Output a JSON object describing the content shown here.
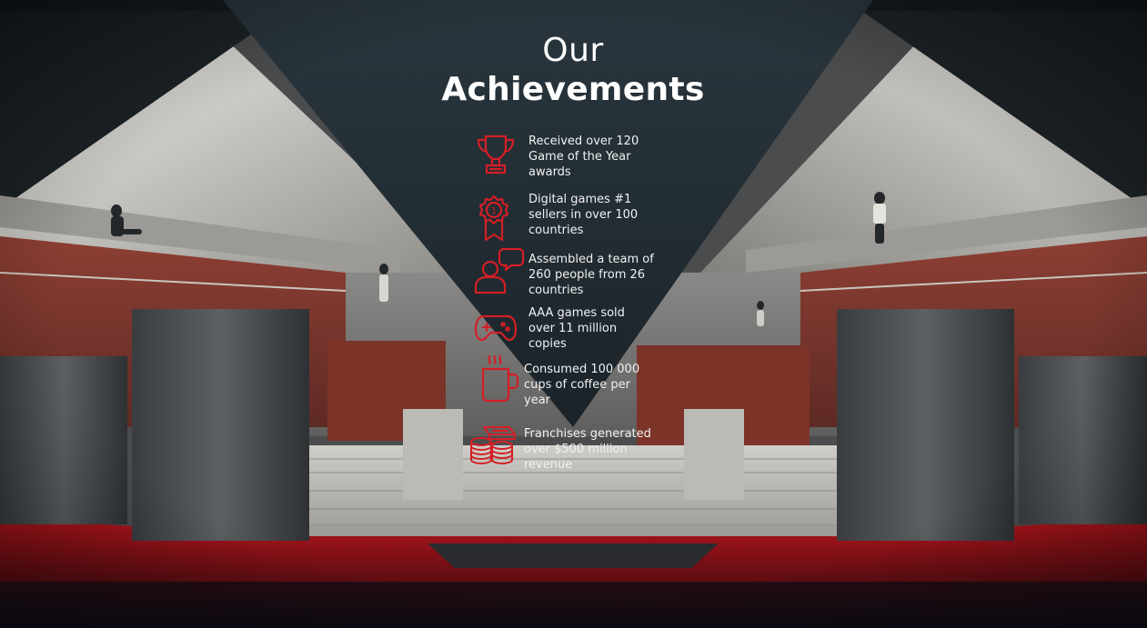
{
  "heading": {
    "line1": "Our",
    "line2": "Achievements"
  },
  "achievements": [
    {
      "icon": "trophy-icon",
      "text": "Received over 120 Game of the Year awards"
    },
    {
      "icon": "medal-icon",
      "text": "Digital games #1 sellers in over 100 countries"
    },
    {
      "icon": "team-chat-icon",
      "text": "Assembled a team of 260 people from 26 countries"
    },
    {
      "icon": "gamepad-icon",
      "text": "AAA games sold over 11 million copies"
    },
    {
      "icon": "coffee-cup-icon",
      "text": "Consumed 100 000 cups of coffee per year"
    },
    {
      "icon": "money-stack-icon",
      "text": "Franchises generated over $500 million revenue"
    }
  ],
  "colors": {
    "accent": "#d41f26",
    "text": "#ffffff",
    "triangle": "#1f2a33"
  }
}
